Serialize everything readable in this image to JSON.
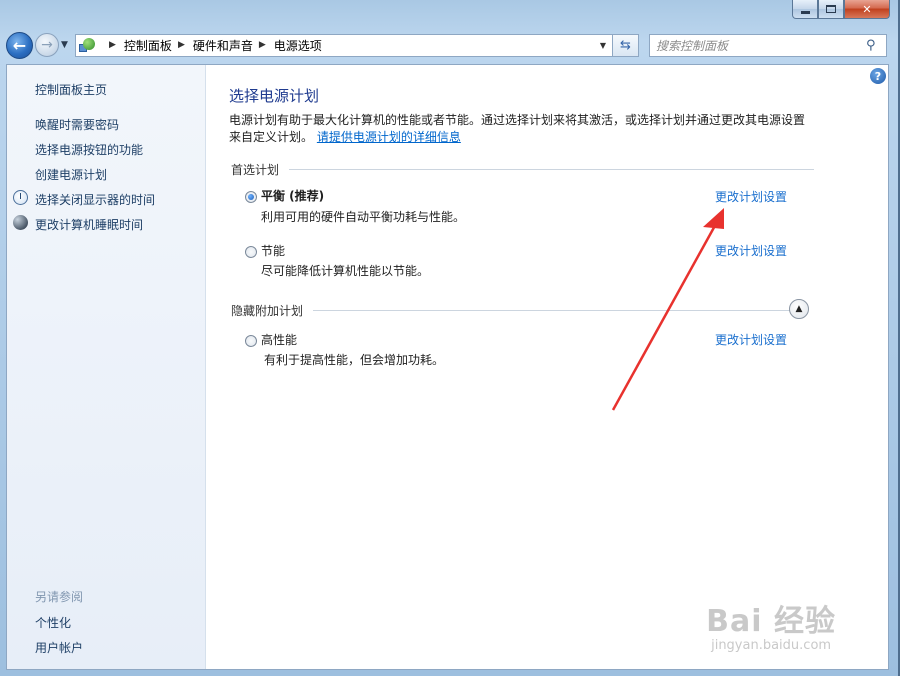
{
  "window": {
    "min_label": "",
    "max_label": "",
    "close_label": "✕"
  },
  "nav": {
    "back_icon": "←",
    "forward_icon": "→",
    "breadcrumbs": [
      "控制面板",
      "硬件和声音",
      "电源选项"
    ],
    "search_placeholder": "搜索控制面板"
  },
  "sidebar": {
    "home": "控制面板主页",
    "items": [
      {
        "label": "唤醒时需要密码",
        "icon": ""
      },
      {
        "label": "选择电源按钮的功能",
        "icon": ""
      },
      {
        "label": "创建电源计划",
        "icon": ""
      },
      {
        "label": "选择关闭显示器的时间",
        "icon": "clock-icon"
      },
      {
        "label": "更改计算机睡眠时间",
        "icon": "moon-icon"
      }
    ],
    "see_also_title": "另请参阅",
    "see_also": [
      "个性化",
      "用户帐户"
    ]
  },
  "main": {
    "title": "选择电源计划",
    "intro_line1": "电源计划有助于最大化计算机的性能或者节能。通过选择计划来将其激活，或选择计划并通过更改其电源设置",
    "intro_line2": "来自定义计划。",
    "intro_link": "请提供电源计划的详细信息",
    "preferred_header": "首选计划",
    "hidden_header": "隐藏附加计划",
    "plans": [
      {
        "name": "平衡 (推荐)",
        "desc": "利用可用的硬件自动平衡功耗与性能。",
        "link": "更改计划设置",
        "selected": true
      },
      {
        "name": "节能",
        "desc": "尽可能降低计算机性能以节能。",
        "link": "更改计划设置",
        "selected": false
      },
      {
        "name": "高性能",
        "desc": "有利于提高性能，但会增加功耗。",
        "link": "更改计划设置",
        "selected": false
      }
    ]
  },
  "watermark": {
    "brand": "Bai 经验",
    "url": "jingyan.baidu.com"
  },
  "colors": {
    "title": "#1f3b8f",
    "link": "#1a6fce",
    "annotation_arrow": "#e8322e"
  }
}
